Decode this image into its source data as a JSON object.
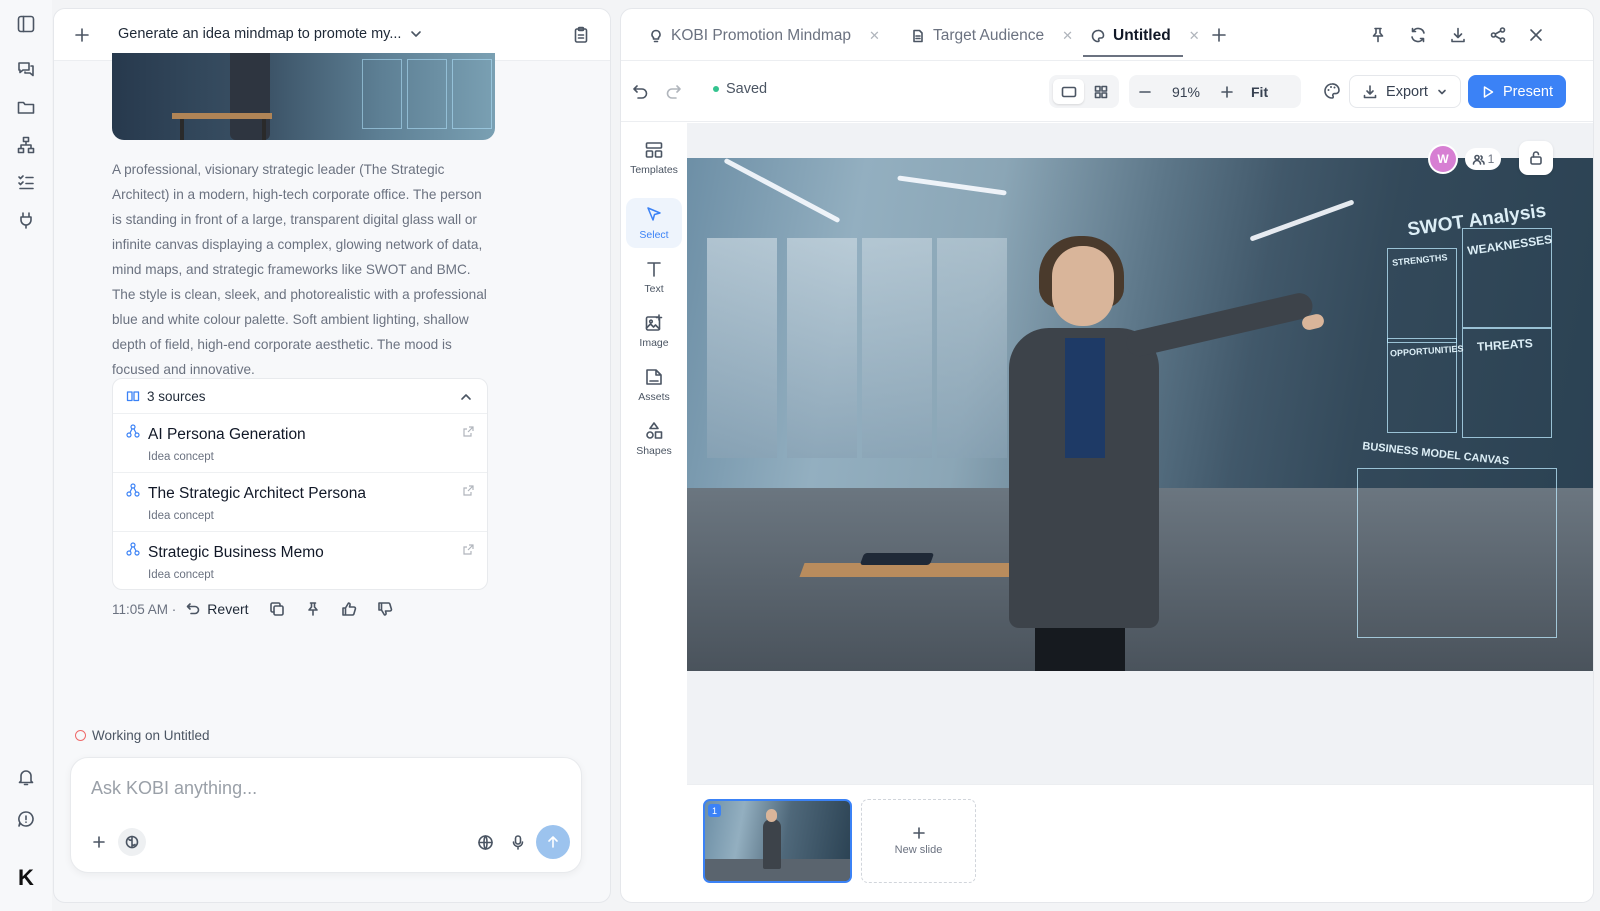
{
  "rail": {
    "logo": "K"
  },
  "chat": {
    "title": "Generate an idea mindmap to promote my...",
    "description": "A professional, visionary strategic leader (The Strategic Architect) in a modern, high-tech corporate office. The person is standing in front of a large, transparent digital glass wall or infinite canvas displaying a complex, glowing network of data, mind maps, and strategic frameworks like SWOT and BMC. The style is clean, sleek, and photorealistic with a professional blue and white colour palette. Soft ambient lighting, shallow depth of field, high-end corporate aesthetic. The mood is focused and innovative.",
    "sources": {
      "label": "3 sources",
      "items": [
        {
          "title": "AI Persona Generation",
          "subtitle": "Idea concept"
        },
        {
          "title": "The Strategic Architect Persona",
          "subtitle": "Idea concept"
        },
        {
          "title": "Strategic Business Memo",
          "subtitle": "Idea concept"
        }
      ]
    },
    "timestamp": "11:05 AM ·",
    "revert_label": "Revert",
    "working_on": "Working on Untitled",
    "composer_placeholder": "Ask KOBI anything..."
  },
  "editor": {
    "tabs": [
      {
        "label": "KOBI Promotion Mindmap",
        "active": false
      },
      {
        "label": "Target Audience",
        "active": false
      },
      {
        "label": "Untitled",
        "active": true
      }
    ],
    "saved_label": "Saved",
    "zoom": "91%",
    "fit_label": "Fit",
    "export_label": "Export",
    "present_label": "Present",
    "tools": [
      {
        "label": "Templates",
        "icon": "templates-icon"
      },
      {
        "label": "Select",
        "icon": "cursor-icon",
        "active": true
      },
      {
        "label": "Text",
        "icon": "text-icon"
      },
      {
        "label": "Image",
        "icon": "image-icon"
      },
      {
        "label": "Assets",
        "icon": "assets-icon"
      },
      {
        "label": "Shapes",
        "icon": "shapes-icon"
      }
    ],
    "slide_image_text": {
      "swot": "SWOT Analysis",
      "strengths": "STRENGTHS",
      "weaknesses": "WEAKNESSES",
      "opportunities": "OPPORTUNITIES",
      "threats": "THREATS",
      "bmc": "BUSINESS MODEL CANVAS"
    },
    "collaborator_initial": "W",
    "collaborator_count": "1",
    "slide_number": "1",
    "new_slide_label": "New slide"
  },
  "colors": {
    "accent": "#3b82f6",
    "saved_dot": "#34c38f",
    "avatar": "#d77fd3"
  }
}
